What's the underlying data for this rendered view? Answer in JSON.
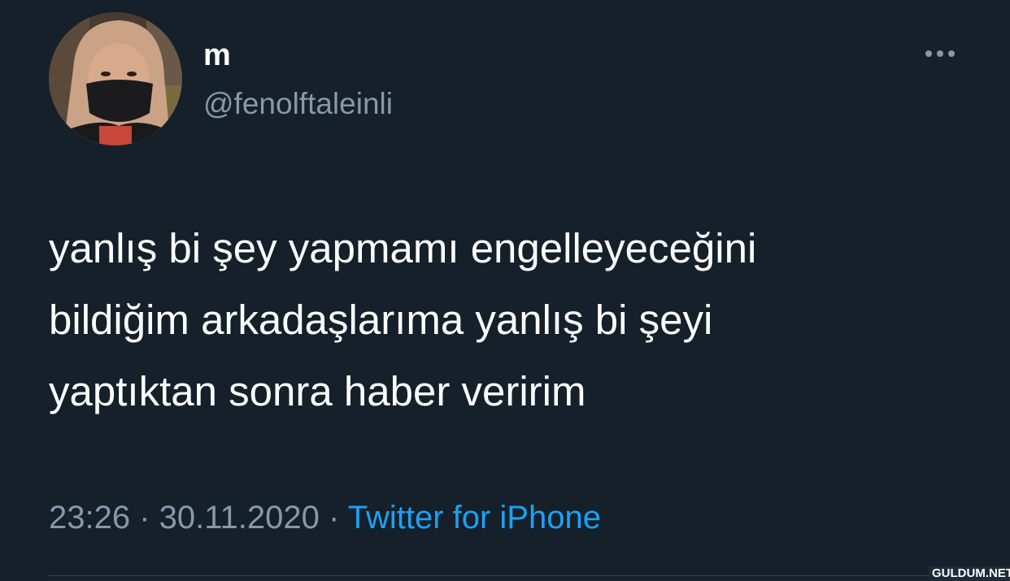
{
  "author": {
    "display_name": "m",
    "handle": "@fenolftaleinli"
  },
  "tweet": {
    "lines": [
      "yanlış bi şey yapmamı engelleyeceğini",
      "bildiğim arkadaşlarıma yanlış bi şeyi",
      "yaptıktan sonra haber veririm"
    ],
    "time": "23:26",
    "separator": " · ",
    "date": "30.11.2020",
    "source": "Twitter for iPhone"
  },
  "icons": {
    "more": "more-horizontal-icon",
    "avatar": "profile-photo"
  },
  "watermark": "GULDUM.NET",
  "colors": {
    "background": "#15202b",
    "primary_text": "#ffffff",
    "secondary_text": "#8899a6",
    "link": "#1da1f2"
  }
}
